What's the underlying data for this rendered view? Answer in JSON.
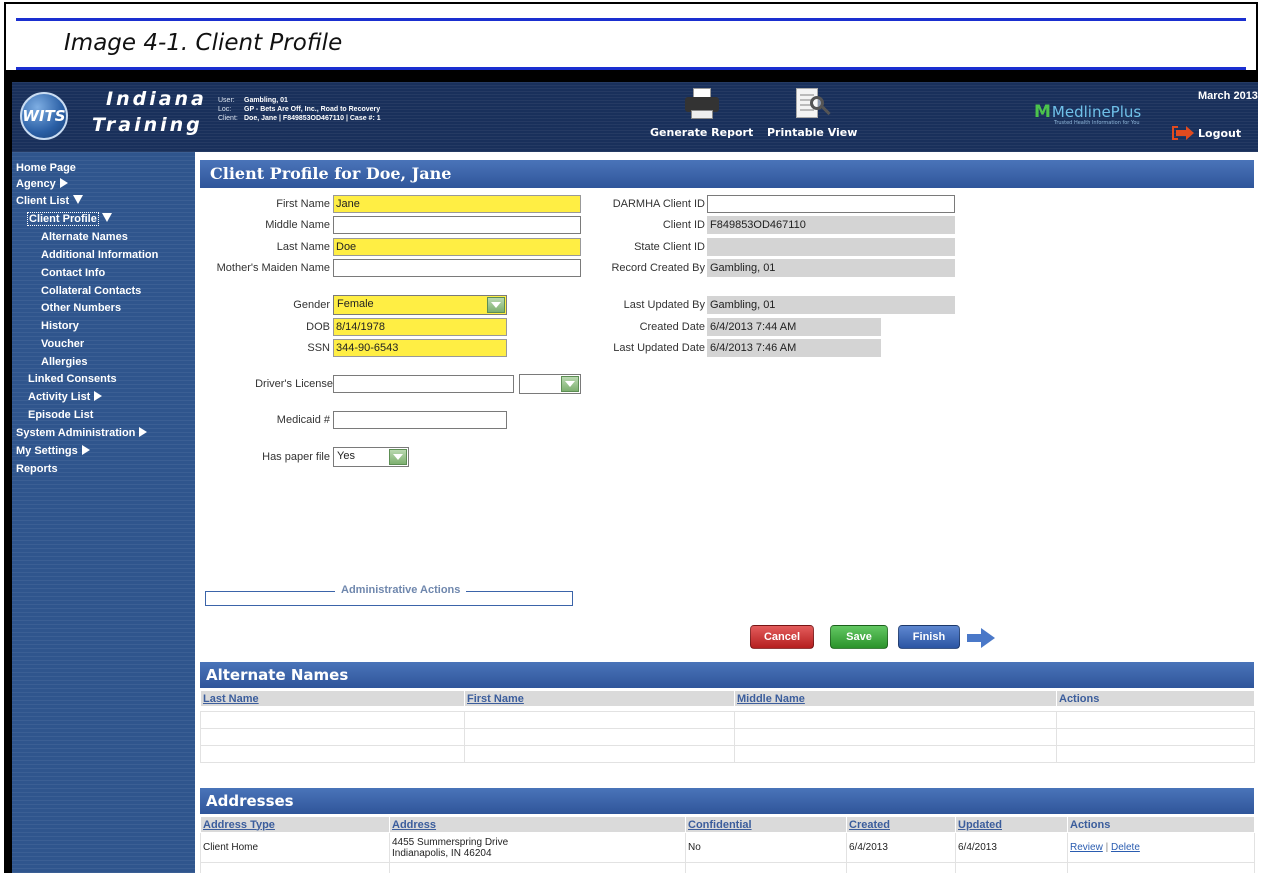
{
  "caption": "Image 4-1. Client Profile",
  "header": {
    "logo_text": "WITS",
    "brand_line1": "Indiana",
    "brand_line2": "Training",
    "user_label": "User:",
    "user_value": "Gambling, 01",
    "loc_label": "Loc:",
    "loc_value": "GP - Bets Are Off, Inc., Road to Recovery",
    "client_label": "Client:",
    "client_value": "Doe, Jane | F849853OD467110 | Case #: 1",
    "generate_report": "Generate Report",
    "printable_view": "Printable View",
    "medline_brand": "MedlinePlus",
    "medline_tagline": "Trusted Health Information for You",
    "date": "March 2013",
    "logout": "Logout"
  },
  "sidebar": {
    "home": "Home Page",
    "agency": "Agency",
    "client_list": "Client List",
    "client_profile": "Client Profile",
    "alternate_names": "Alternate Names",
    "additional_information": "Additional Information",
    "contact_info": "Contact Info",
    "collateral_contacts": "Collateral Contacts",
    "other_numbers": "Other Numbers",
    "history": "History",
    "voucher": "Voucher",
    "allergies": "Allergies",
    "linked_consents": "Linked Consents",
    "activity_list": "Activity List",
    "episode_list": "Episode List",
    "system_administration": "System Administration",
    "my_settings": "My Settings",
    "reports": "Reports"
  },
  "profile": {
    "title": "Client Profile for Doe, Jane",
    "first_name_label": "First Name",
    "first_name": "Jane",
    "middle_name_label": "Middle Name",
    "middle_name": "",
    "last_name_label": "Last Name",
    "last_name": "Doe",
    "maiden_name_label": "Mother's Maiden Name",
    "maiden_name": "",
    "gender_label": "Gender",
    "gender": "Female",
    "dob_label": "DOB",
    "dob": "8/14/1978",
    "ssn_label": "SSN",
    "ssn": "344-90-6543",
    "drivers_license_label": "Driver's License",
    "drivers_license": "",
    "drivers_license_state": "",
    "medicaid_label": "Medicaid #",
    "medicaid": "",
    "paper_file_label": "Has paper file",
    "paper_file": "Yes",
    "darmha_label": "DARMHA Client ID",
    "darmha": "",
    "client_id_label": "Client ID",
    "client_id": "F849853OD467110",
    "state_client_id_label": "State Client ID",
    "state_client_id": "",
    "record_created_by_label": "Record Created By",
    "record_created_by": "Gambling, 01",
    "last_updated_by_label": "Last Updated By",
    "last_updated_by": "Gambling, 01",
    "created_date_label": "Created Date",
    "created_date": "6/4/2013 7:44 AM",
    "last_updated_date_label": "Last Updated Date",
    "last_updated_date": "6/4/2013 7:46 AM",
    "admin_actions": "Administrative Actions",
    "cancel": "Cancel",
    "save": "Save",
    "finish": "Finish"
  },
  "alternate_names": {
    "title": "Alternate Names",
    "columns": [
      "Last Name",
      "First Name",
      "Middle Name",
      "Actions"
    ]
  },
  "addresses": {
    "title": "Addresses",
    "columns": [
      "Address Type",
      "Address",
      "Confidential",
      "Created",
      "Updated",
      "Actions"
    ],
    "rows": [
      {
        "type": "Client Home",
        "address_line1": "4455 Summerspring Drive",
        "address_line2": "Indianapolis, IN 46204",
        "confidential": "No",
        "created": "6/4/2013",
        "updated": "6/4/2013",
        "review": "Review",
        "separator": "|",
        "delete": "Delete"
      }
    ]
  }
}
